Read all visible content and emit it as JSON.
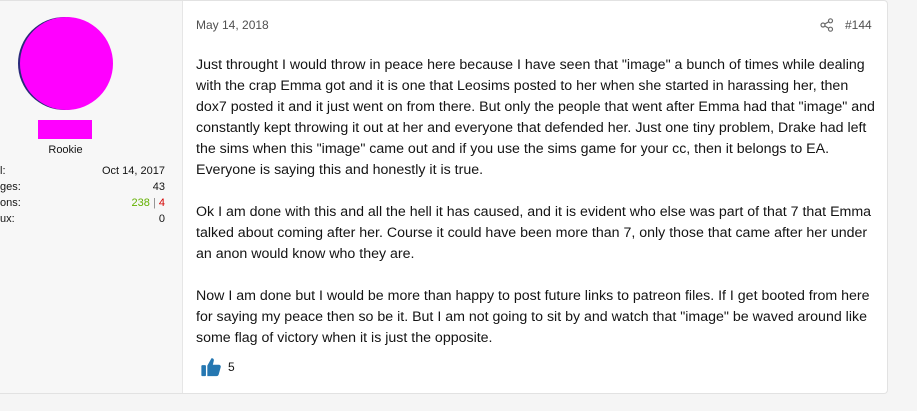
{
  "user": {
    "title": "Rookie",
    "stats": [
      {
        "label": "l:",
        "value": "Oct 14, 2017"
      },
      {
        "label": "ges:",
        "value": "43"
      },
      {
        "label": "ons:",
        "positive": "238",
        "separator": "|",
        "negative": "4"
      },
      {
        "label": "ux:",
        "value": "0"
      }
    ]
  },
  "post": {
    "date": "May 14, 2018",
    "number": "#144",
    "paragraphs": [
      "Just throught I would throw in peace here because I have seen that \"image\" a bunch of times while dealing with the crap Emma got and it is one that Leosims posted to her when she started in harassing her, then dox7 posted it and it just went on from there. But only the people that went after Emma had that \"image\" and constantly kept throwing it out at her and everyone that defended her. Just one tiny problem, Drake had left the sims when this \"image\" came out and if you use the sims game for your cc, then it belongs to EA. Everyone is saying this and honestly it is true.",
      "Ok I am done with this and all the hell it has caused, and it is evident who else was part of that 7 that Emma talked about coming after her. Course it could have been more than 7, only those that came after her under an anon would know who they are.",
      "Now I am done but I would be more than happy to post future links to patreon files. If I get booted from here for saying my peace then so be it. But I am not going to sit by and watch that \"image\" be waved around like some flag of victory when it is just the opposite."
    ],
    "reactions": {
      "icon": "thumbs-up-icon",
      "count": "5"
    }
  },
  "colors": {
    "avatar": "#ff00ff",
    "positive": "#63b000",
    "negative": "#d40000",
    "like": "#2577b1"
  }
}
